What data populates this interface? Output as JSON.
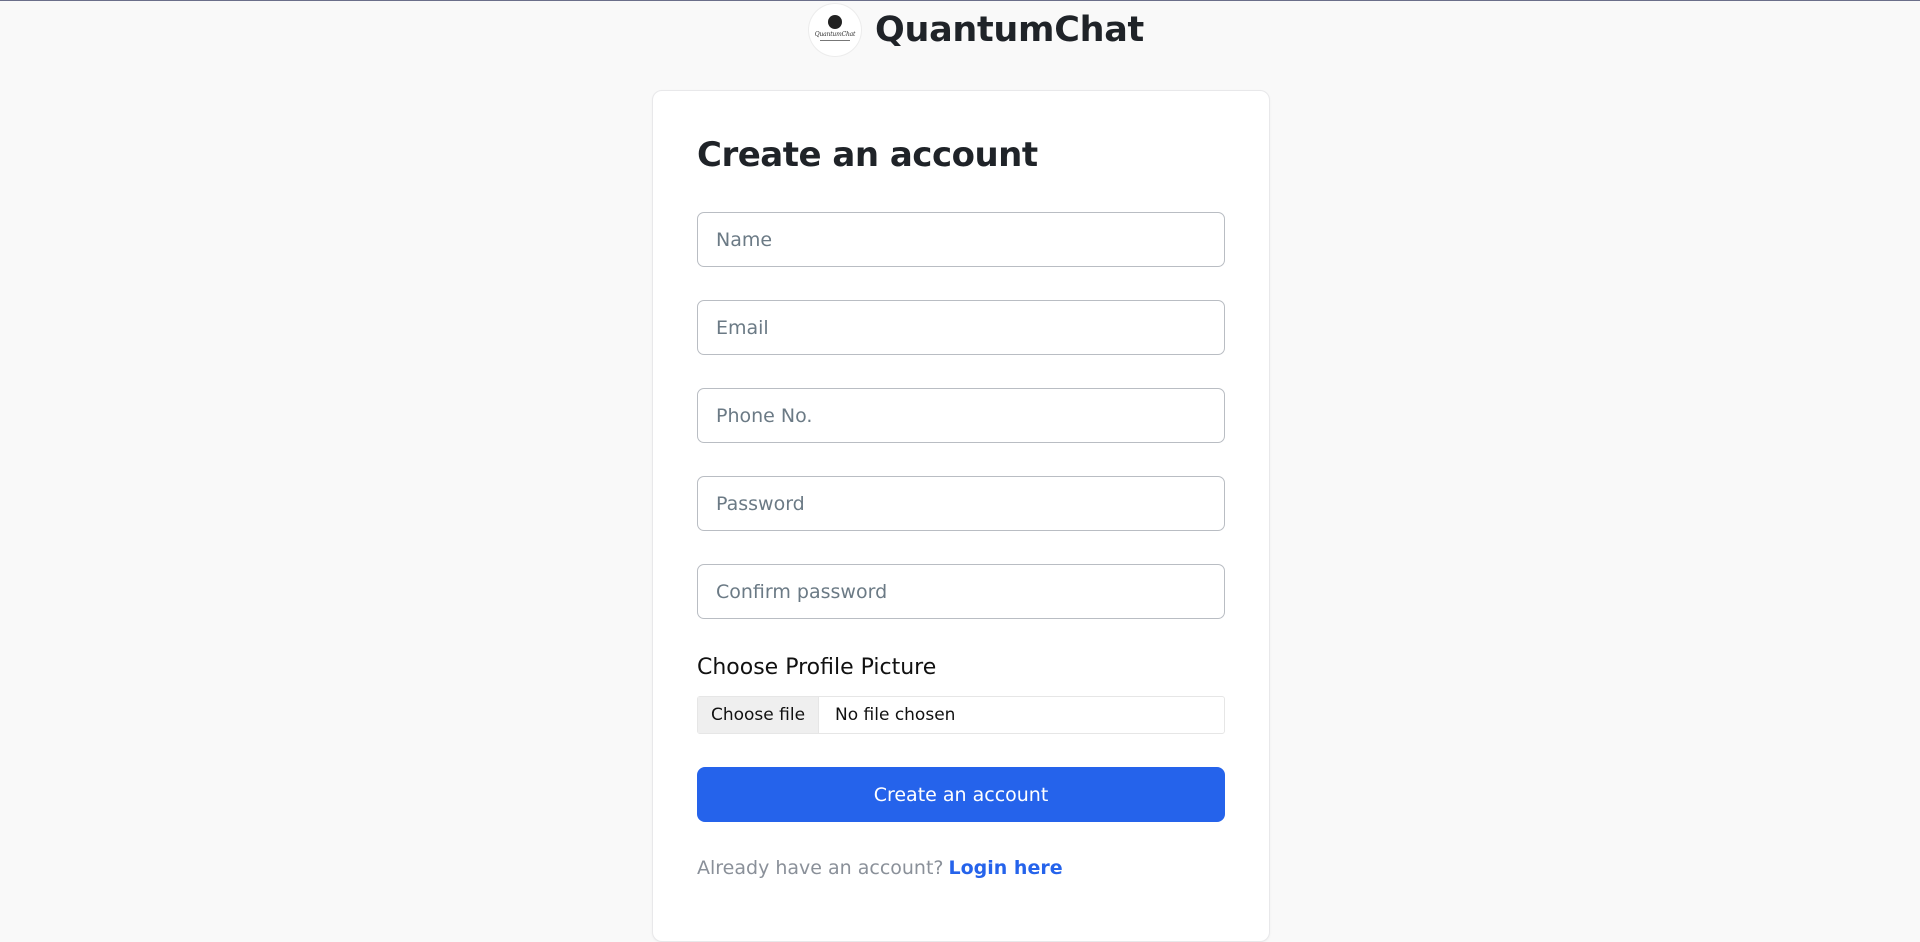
{
  "app": {
    "name": "QuantumChat",
    "logo_text": "QuantumChat"
  },
  "form": {
    "title": "Create an account",
    "fields": {
      "name_placeholder": "Name",
      "email_placeholder": "Email",
      "phone_placeholder": "Phone No.",
      "password_placeholder": "Password",
      "confirm_password_placeholder": "Confirm password"
    },
    "profile_picture": {
      "label": "Choose Profile Picture",
      "button_label": "Choose file",
      "status": "No file chosen"
    },
    "submit_label": "Create an account",
    "footer": {
      "prompt": "Already have an account?",
      "link_label": "Login here"
    }
  },
  "colors": {
    "accent": "#2563eb",
    "background": "#f9f9f9",
    "card": "#ffffff",
    "heading": "#1f2328",
    "muted": "#8a9099"
  },
  "icons": {
    "brand": "quantumchat-logo-icon"
  }
}
